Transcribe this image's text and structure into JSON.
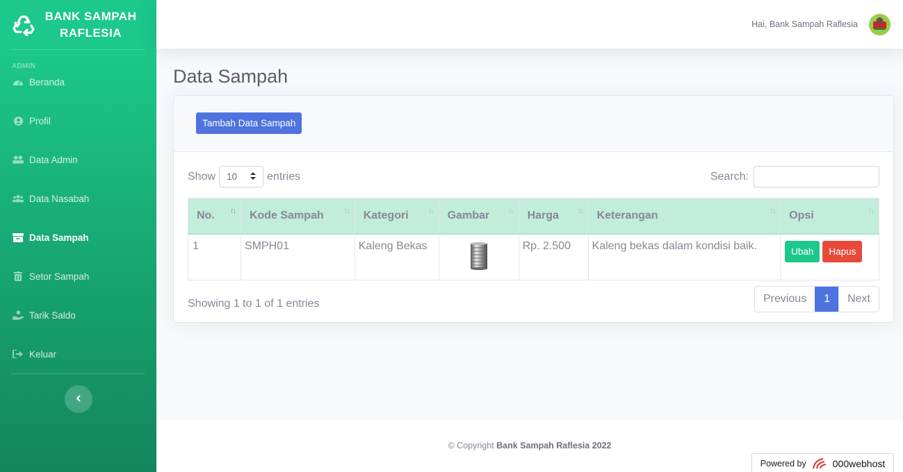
{
  "brand": {
    "line1": "BANK SAMPAH",
    "line2": "RAFLESIA",
    "icon": "recycle-icon"
  },
  "sidebar": {
    "heading": "ADMIN",
    "items": [
      {
        "label": "Beranda",
        "icon": "dashboard-icon",
        "active": false
      },
      {
        "label": "Profil",
        "icon": "user-circle-icon",
        "active": false
      },
      {
        "label": "Data Admin",
        "icon": "user-group-icon",
        "active": false
      },
      {
        "label": "Data Nasabah",
        "icon": "users-icon",
        "active": false
      },
      {
        "label": "Data Sampah",
        "icon": "box-icon",
        "active": true
      },
      {
        "label": "Setor Sampah",
        "icon": "trash-icon",
        "active": false
      },
      {
        "label": "Tarik Saldo",
        "icon": "hand-coin-icon",
        "active": false
      },
      {
        "label": "Keluar",
        "icon": "sign-out-icon",
        "active": false
      }
    ]
  },
  "topbar": {
    "greeting": "Hai, Bank Sampah Raflesia"
  },
  "page": {
    "title": "Data Sampah"
  },
  "card": {
    "add_button": "Tambah Data Sampah",
    "show_label": "Show",
    "entries_label": "entries",
    "page_length": "10",
    "search_label": "Search:",
    "search_value": ""
  },
  "table": {
    "columns": [
      "No.",
      "Kode Sampah",
      "Kategori",
      "Gambar",
      "Harga",
      "Keterangan",
      "Opsi"
    ],
    "rows": [
      {
        "no": "1",
        "kode": "SMPH01",
        "kategori": "Kaleng Bekas",
        "harga": "Rp. 2.500",
        "keterangan": "Kaleng bekas dalam kondisi baik.",
        "edit": "Ubah",
        "delete": "Hapus"
      }
    ]
  },
  "pagination": {
    "info": "Showing 1 to 1 of 1 entries",
    "previous": "Previous",
    "current": "1",
    "next": "Next"
  },
  "footer": {
    "copyright": "© Copyright",
    "owner": "Bank Sampah Raflesia 2022"
  },
  "powered": {
    "label": "Powered by",
    "host": "000webhost"
  },
  "colors": {
    "sidebar_top": "#1cc88a",
    "sidebar_bottom": "#13855c",
    "primary": "#4e73df",
    "success": "#1cc88a",
    "danger": "#e74a3b",
    "table_head": "#c2eddb"
  }
}
